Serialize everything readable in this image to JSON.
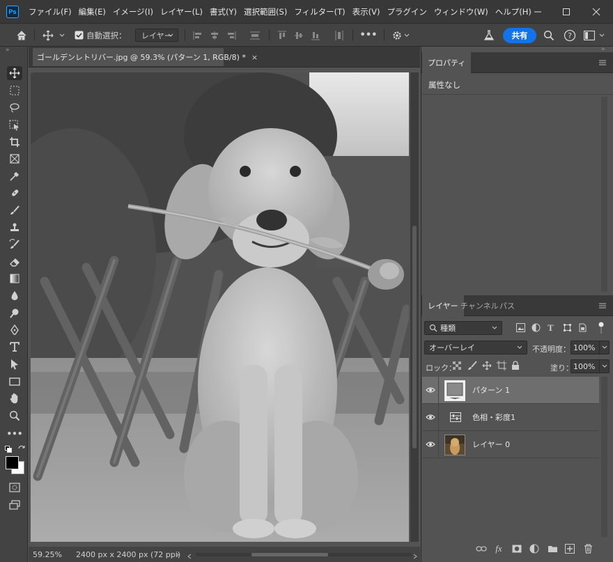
{
  "app": {
    "logo": "Ps"
  },
  "menu": [
    "ファイル(F)",
    "編集(E)",
    "イメージ(I)",
    "レイヤー(L)",
    "書式(Y)",
    "選択範囲(S)",
    "フィルター(T)",
    "表示(V)",
    "プラグイン",
    "ウィンドウ(W)",
    "ヘルプ(H)"
  ],
  "options_bar": {
    "auto_select_label": "自動選択：",
    "auto_select_checked": true,
    "auto_select_target": "レイヤー",
    "more_label": "•••",
    "share_label": "共有"
  },
  "document": {
    "tab_title": "ゴールデンレトリバー.jpg @ 59.3% (パターン 1, RGB/8) *",
    "close_glyph": "×"
  },
  "status": {
    "zoom": "59.25%",
    "doc_info": "2400 px x 2400 px (72 ppi)",
    "arrow": "›"
  },
  "properties_panel": {
    "tab": "プロパティ",
    "content": "属性なし"
  },
  "layers_panel": {
    "tabs": [
      "レイヤー",
      "チャンネル",
      "パス"
    ],
    "filter_kind": "種類",
    "blend_mode": "オーバーレイ",
    "opacity_label": "不透明度：",
    "opacity_value": "100%",
    "lock_label": "ロック：",
    "fill_label": "塗り：",
    "fill_value": "100%",
    "layers": [
      {
        "name": "パターン 1",
        "type": "pattern",
        "visible": true,
        "selected": true
      },
      {
        "name": "色相・彩度1",
        "type": "adjustment",
        "visible": true,
        "selected": false
      },
      {
        "name": "レイヤー 0",
        "type": "image",
        "visible": true,
        "selected": false
      }
    ]
  },
  "colors": {
    "accent": "#1473e6",
    "panel_bg": "#535353",
    "menubar_bg": "#383838"
  }
}
